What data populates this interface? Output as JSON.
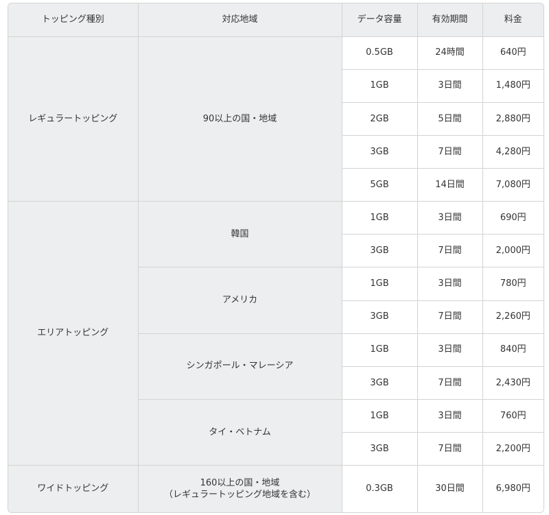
{
  "headers": {
    "type": "トッピング種別",
    "region": "対応地域",
    "data": "データ容量",
    "period": "有効期間",
    "price": "料金"
  },
  "groups": [
    {
      "name": "レギュラートッピング",
      "regions": [
        {
          "name": "90以上の国・地域",
          "plans": [
            {
              "data": "0.5GB",
              "period": "24時間",
              "price": "640円"
            },
            {
              "data": "1GB",
              "period": "3日間",
              "price": "1,480円"
            },
            {
              "data": "2GB",
              "period": "5日間",
              "price": "2,880円"
            },
            {
              "data": "3GB",
              "period": "7日間",
              "price": "4,280円"
            },
            {
              "data": "5GB",
              "period": "14日間",
              "price": "7,080円"
            }
          ]
        }
      ]
    },
    {
      "name": "エリアトッピング",
      "regions": [
        {
          "name": "韓国",
          "plans": [
            {
              "data": "1GB",
              "period": "3日間",
              "price": "690円"
            },
            {
              "data": "3GB",
              "period": "7日間",
              "price": "2,000円"
            }
          ]
        },
        {
          "name": "アメリカ",
          "plans": [
            {
              "data": "1GB",
              "period": "3日間",
              "price": "780円"
            },
            {
              "data": "3GB",
              "period": "7日間",
              "price": "2,260円"
            }
          ]
        },
        {
          "name": "シンガポール・マレーシア",
          "plans": [
            {
              "data": "1GB",
              "period": "3日間",
              "price": "840円"
            },
            {
              "data": "3GB",
              "period": "7日間",
              "price": "2,430円"
            }
          ]
        },
        {
          "name": "タイ・ベトナム",
          "plans": [
            {
              "data": "1GB",
              "period": "3日間",
              "price": "760円"
            },
            {
              "data": "3GB",
              "period": "7日間",
              "price": "2,200円"
            }
          ]
        }
      ]
    },
    {
      "name": "ワイドトッピング",
      "regions": [
        {
          "name": "160以上の国・地域",
          "note": "（レギュラートッピング地域を含む）",
          "plans": [
            {
              "data": "0.3GB",
              "period": "30日間",
              "price": "6,980円"
            }
          ]
        }
      ]
    }
  ]
}
